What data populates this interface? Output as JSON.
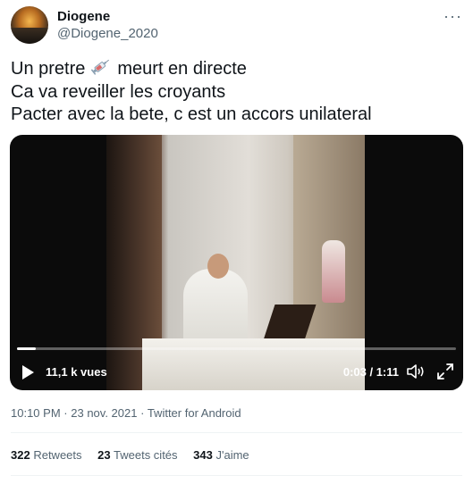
{
  "author": {
    "name": "Diogene",
    "handle": "@Diogene_2020"
  },
  "more_menu": "···",
  "tweet": {
    "lines": [
      "Un pretre",
      "meurt en directe",
      "Ca va reveiller les croyants",
      "Pacter avec la bete, c est un accors unilateral"
    ],
    "emoji": "syringe-icon"
  },
  "video": {
    "views": "11,1 k vues",
    "time": "0:03 / 1:11",
    "progress_fraction": 0.042
  },
  "meta": {
    "time": "10:10 PM",
    "date": "23 nov. 2021",
    "source": "Twitter for Android",
    "sep": "·"
  },
  "stats": {
    "retweets_count": "322",
    "retweets_label": "Retweets",
    "quotes_count": "23",
    "quotes_label": "Tweets cités",
    "likes_count": "343",
    "likes_label": "J'aime"
  },
  "colors": {
    "text": "#0f1419",
    "secondary": "#536471",
    "divider": "#eff3f4"
  }
}
